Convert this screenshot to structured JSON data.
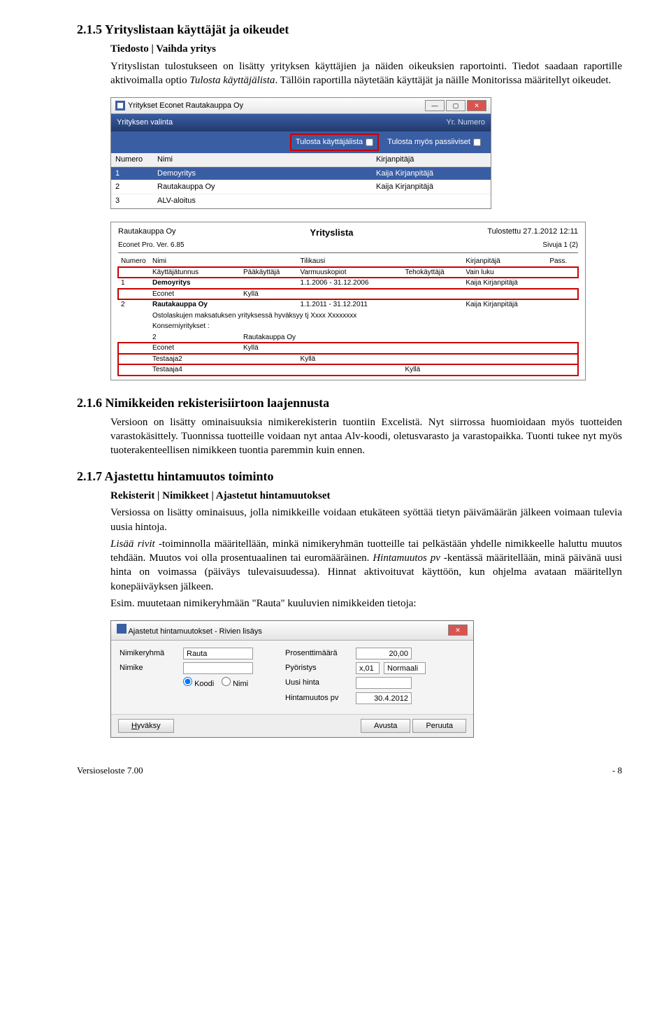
{
  "sec215": {
    "heading": "2.1.5 Yrityslistaan käyttäjät ja oikeudet",
    "line1_bold": "Tiedosto | Vaihda yritys",
    "p1a": "Yrityslistan tulostukseen on lisätty yrityksen käyttäjien ja näiden oikeuksien raportointi. Tiedot saadaan raportille aktivoimalla optio ",
    "p1i": "Tulosta käyttäjälista",
    "p1b": ". Tällöin raportilla näytetään käyttäjät ja näille Monitorissa määritellyt oikeudet."
  },
  "appwin": {
    "title": "Yritykset Econet Rautakauppa Oy",
    "sub_title": "Yrityksen valinta",
    "sub_right": "Yr. Numero",
    "chk1": "Tulosta käyttäjälista",
    "chk2": "Tulosta myös passiiviset",
    "cols": [
      "Numero",
      "Nimi",
      "Kirjanpitäjä"
    ],
    "rows": [
      [
        "1",
        "Demoyritys",
        "Kaija Kirjanpitäjä"
      ],
      [
        "2",
        "Rautakauppa Oy",
        "Kaija Kirjanpitäjä"
      ],
      [
        "3",
        "ALV-aloitus",
        ""
      ]
    ]
  },
  "report": {
    "company": "Rautakauppa Oy",
    "title": "Yrityslista",
    "printed": "Tulostettu 27.1.2012 12:11",
    "ver": "Econet Pro. Ver. 6.85",
    "pages": "Sivuja 1 (2)",
    "head": [
      "Numero",
      "Nimi",
      "Tilikausi",
      "Kirjanpitäjä",
      "Pass."
    ],
    "sub_head": [
      "Käyttäjätunnus",
      "Pääkäyttäjä",
      "Varmuuskopiot",
      "Tehokäyttäjä",
      "Vain luku"
    ],
    "r1_num": "1",
    "r1_name": "Demoyritys",
    "r1_period": "1.1.2006 - 31.12.2006",
    "r1_kp": "Kaija Kirjanpitäjä",
    "r1_user": "Econet",
    "r1_paa": "Kyllä",
    "r2_num": "2",
    "r2_name": "Rautakauppa Oy",
    "r2_period": "1.1.2011 - 31.12.2011",
    "r2_kp": "Kaija Kirjanpitäjä",
    "r2_note": "Ostolaskujen maksatuksen yrityksessä hyväksyy tj Xxxx Xxxxxxxx",
    "r2_kons": "Konserniyritykset :",
    "r2_kons2": "2",
    "r2_kons3": "Rautakauppa Oy",
    "u1": "Econet",
    "u1v": "Kyllä",
    "u2": "Testaaja2",
    "u2v": "Kyllä",
    "u3": "Testaaja4",
    "u3v": "Kyllä"
  },
  "sec216": {
    "heading": "2.1.6 Nimikkeiden rekisterisiirtoon laajennusta",
    "p": "Versioon on lisätty ominaisuuksia nimikerekisterin tuontiin Excelistä. Nyt siirrossa huomioidaan myös tuotteiden varastokäsittely. Tuonnissa tuotteille voidaan nyt antaa Alv-koodi, oletusvarasto ja varastopaikka. Tuonti tukee nyt myös tuoterakenteellisen nimikkeen tuontia paremmin kuin ennen."
  },
  "sec217": {
    "heading": "2.1.7 Ajastettu hintamuutos toiminto",
    "line1_bold": "Rekisterit | Nimikkeet | Ajastetut hintamuutokset",
    "p1": "Versiossa on lisätty ominaisuus, jolla nimikkeille voidaan etukäteen syöttää tietyn päivämäärän jälkeen voimaan tulevia uusia hintoja.",
    "p2a": "Lisää rivit",
    "p2b": " -toiminnolla määritellään, minkä nimikeryhmän tuotteille tai pelkästään yhdelle nimikkeelle haluttu muutos tehdään. Muutos voi olla prosentuaalinen tai euromääräinen. ",
    "p2c": "Hintamuutos pv",
    "p2d": " -kentässä määritellään, minä päivänä uusi hinta on voimassa (päiväys tulevaisuudessa). Hinnat aktivoituvat käyttöön, kun ohjelma avataan määritellyn konepäiväyksen jälkeen.",
    "p3": "Esim. muutetaan nimikeryhmään \"Rauta\" kuuluvien nimikkeiden tietoja:"
  },
  "dialog": {
    "title": "Ajastetut hintamuutokset - Rivien lisäys",
    "l_nimikeryhma": "Nimikeryhmä",
    "v_nimikeryhma": "Rauta",
    "l_nimike": "Nimike",
    "r_koodi": "Koodi",
    "r_nimi": "Nimi",
    "l_pros": "Prosenttimäärä",
    "v_pros": "20,00",
    "l_pyor": "Pyöristys",
    "v_pyor1": "x,01",
    "v_pyor2": "Normaali",
    "l_uusi": "Uusi hinta",
    "l_pv": "Hintamuutos pv",
    "v_pv": "30.4.2012",
    "btn_ok": "Hyväksy",
    "btn_help": "Avusta",
    "btn_cancel": "Peruuta"
  },
  "footer": {
    "left": "Versioseloste 7.00",
    "right": "- 8"
  }
}
